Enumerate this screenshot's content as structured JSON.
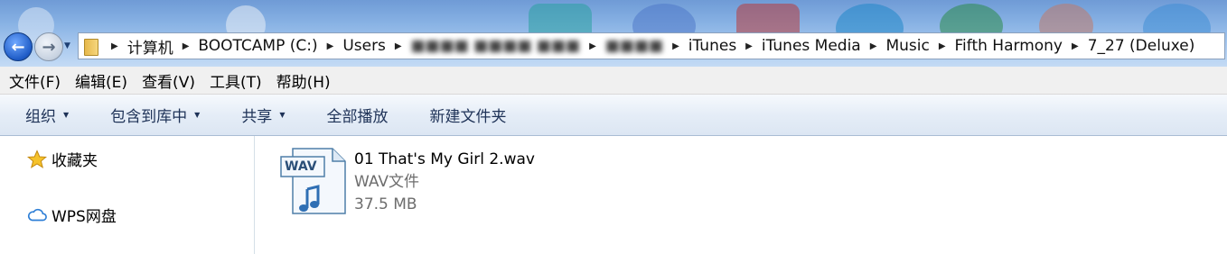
{
  "address": {
    "crumbs": [
      "计算机",
      "BOOTCAMP (C:)",
      "Users",
      "■■■■ ■■■■ ■■■",
      "■■■■",
      "iTunes",
      "iTunes Media",
      "Music",
      "Fifth Harmony",
      "7_27 (Deluxe)"
    ]
  },
  "menu": [
    "文件(F)",
    "编辑(E)",
    "查看(V)",
    "工具(T)",
    "帮助(H)"
  ],
  "commands": {
    "organize": "组织",
    "include_library": "包含到库中",
    "share": "共享",
    "play_all": "全部播放",
    "new_folder": "新建文件夹"
  },
  "nav": {
    "favorites": "收藏夹",
    "wps": "WPS网盘"
  },
  "file": {
    "name": "01 That's My Girl 2.wav",
    "type": "WAV文件",
    "size": "37.5 MB",
    "badge": "WAV"
  },
  "icons": {
    "back": "back-arrow-icon",
    "forward": "forward-arrow-icon",
    "folder": "folder-icon",
    "star": "star-icon",
    "cloud": "cloud-icon",
    "audio_file": "wav-file-icon"
  }
}
